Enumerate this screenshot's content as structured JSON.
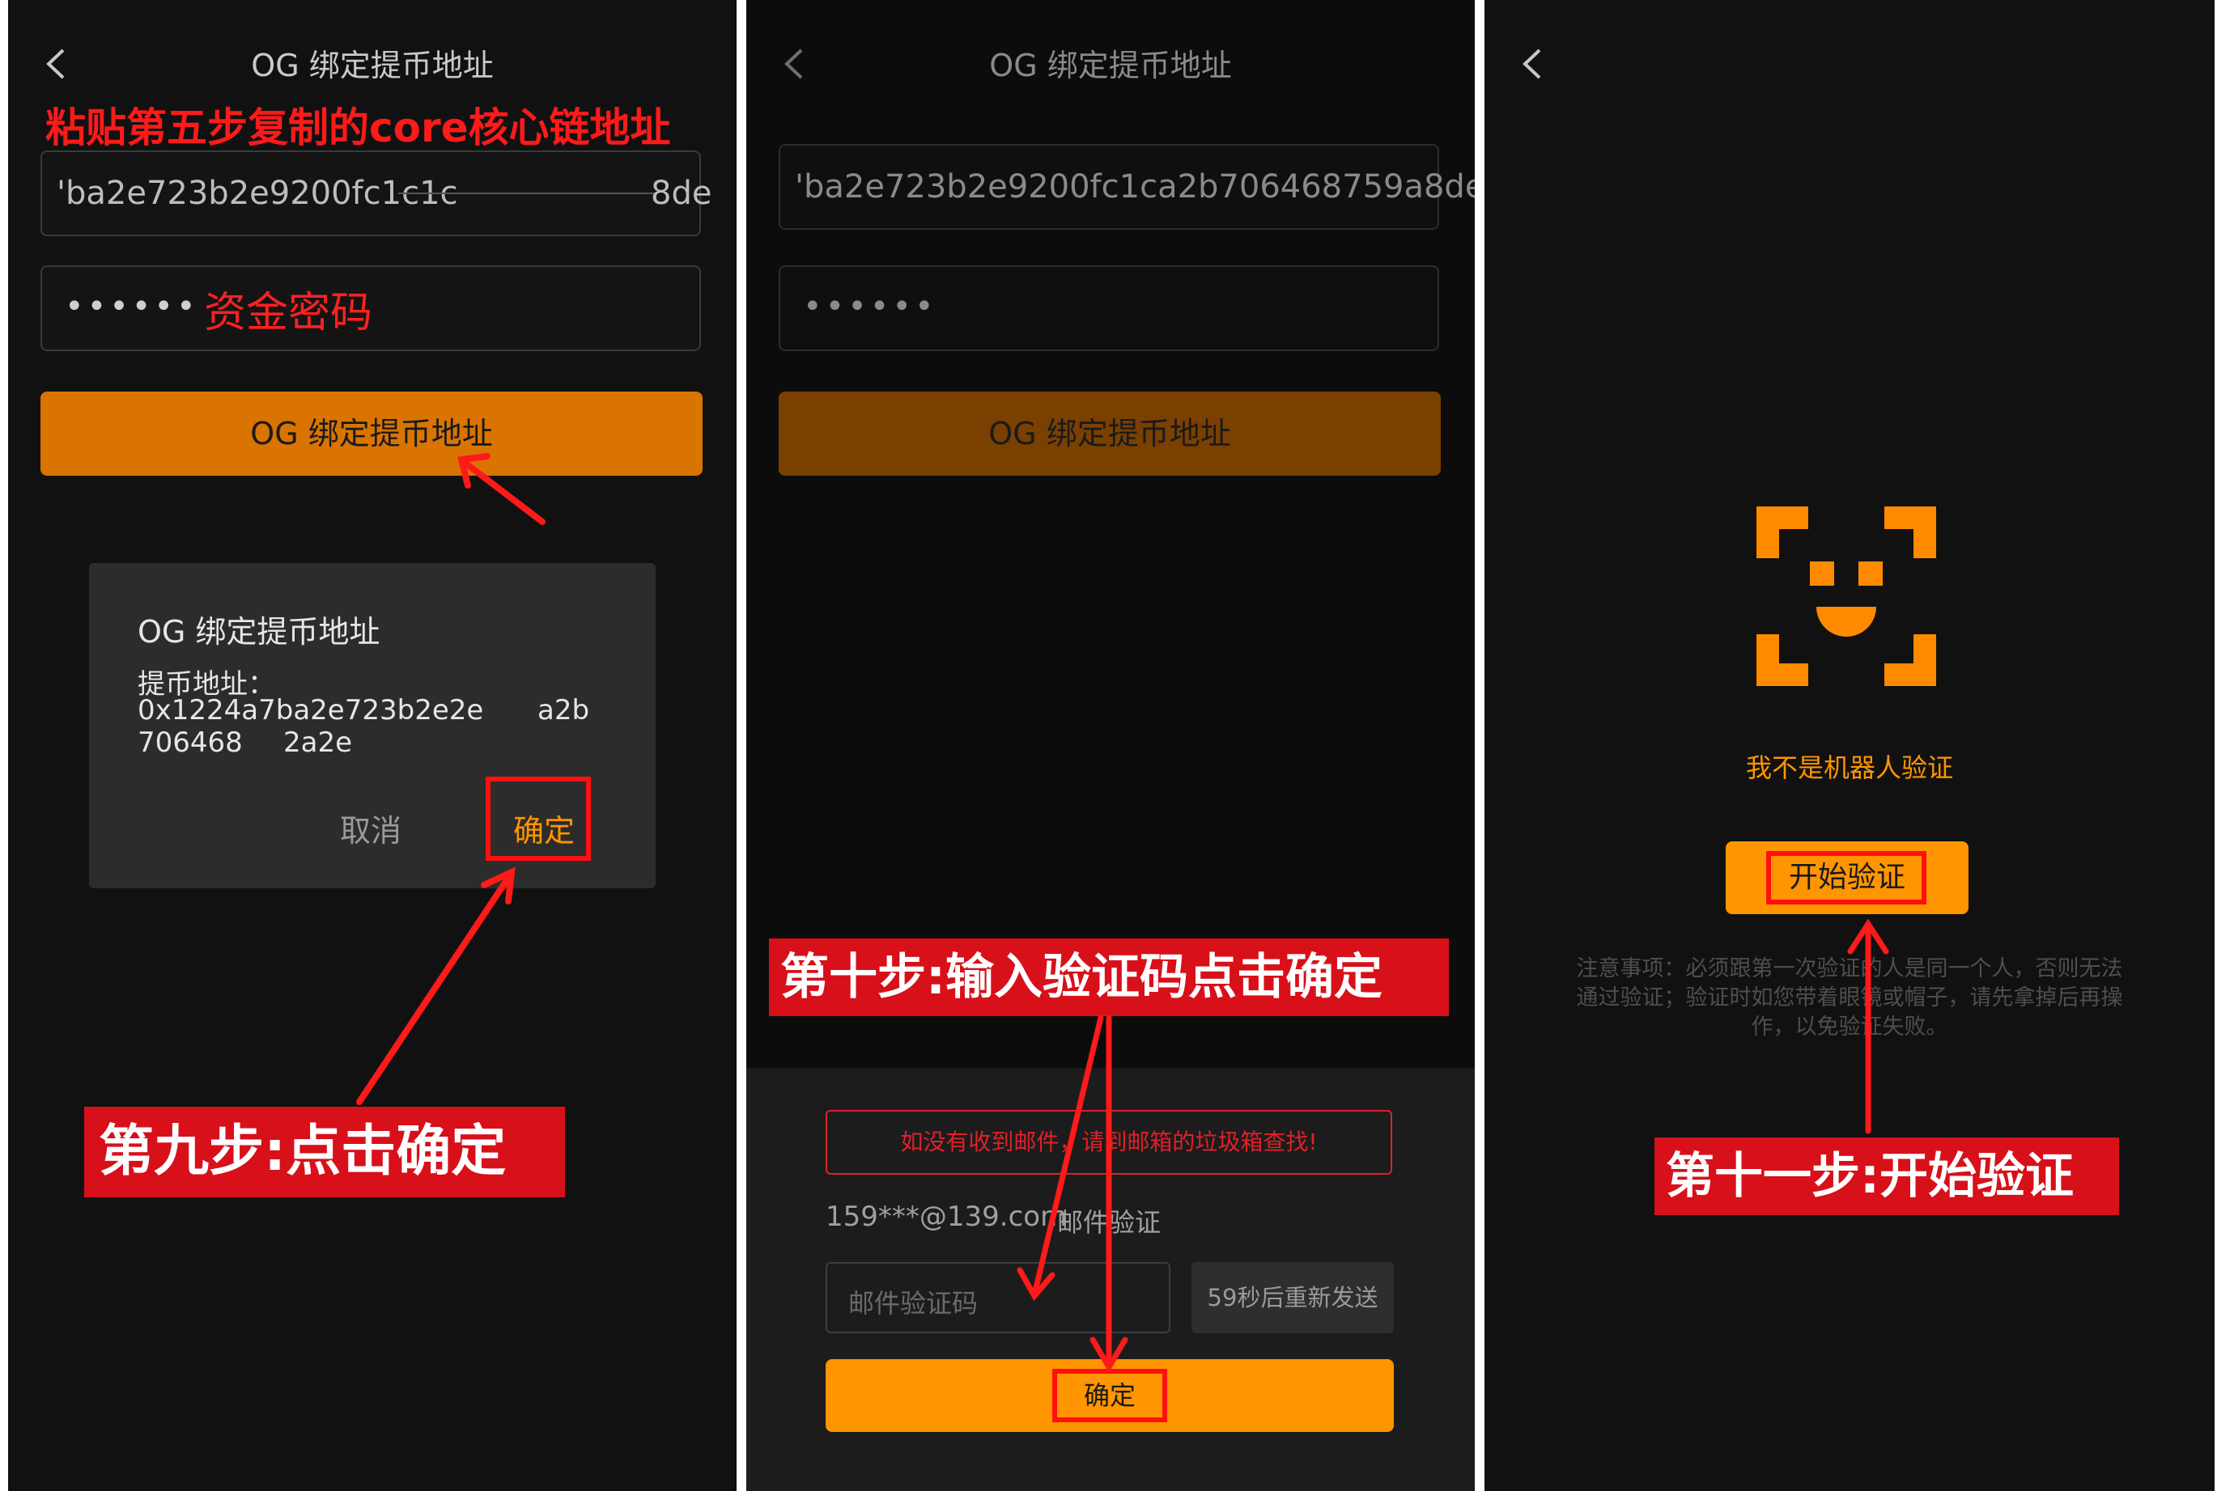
{
  "panel1": {
    "title": "OG 绑定提币地址",
    "annotation_paste": "粘贴第五步复制的core核心链地址",
    "address_field_value": "'ba2e723b2e9200fc1c1c",
    "address_field_tail": "8de",
    "password_dots": "••••••",
    "annotation_password": "资金密码",
    "bind_button": "OG 绑定提币地址",
    "dialog": {
      "title": "OG 绑定提币地址",
      "label": "提币地址：",
      "address_line1": "0x1224a7ba2e723b2e2e",
      "address_line1_tail": "a2b",
      "address_line2": "706468",
      "address_line2_tail": "2a2e",
      "cancel": "取消",
      "confirm": "确定"
    },
    "callout": "第九步:点击确定"
  },
  "panel2": {
    "title": "OG 绑定提币地址",
    "address_field_value": "'ba2e723b2e9200fc1ca2b706468759a8de",
    "password_dots": "••••••",
    "bind_button": "OG 绑定提币地址",
    "callout": "第十步:输入验证码点击确定",
    "notice": "如没有收到邮件，请到邮箱的垃圾箱查找!",
    "email": "159***@139.com",
    "email_verify_label": "邮件验证",
    "code_placeholder": "邮件验证码",
    "resend": "59秒后重新发送",
    "confirm": "确定"
  },
  "panel3": {
    "robot_label": "我不是机器人验证",
    "start_button": "开始验证",
    "note_line1": "注意事项：必须跟第一次验证的人是同一个人，否则无法",
    "note_line2": "通过验证；验证时如您带着眼镜或帽子，请先拿掉后再操",
    "note_line3": "作，以免验证失败。",
    "callout": "第十一步:开始验证"
  },
  "colors": {
    "accent_orange": "#ff9500",
    "annotation_red": "#d8101a",
    "background": "#111111"
  },
  "icons": [
    "back-chevron-icon",
    "face-scan-icon",
    "red-arrow"
  ]
}
